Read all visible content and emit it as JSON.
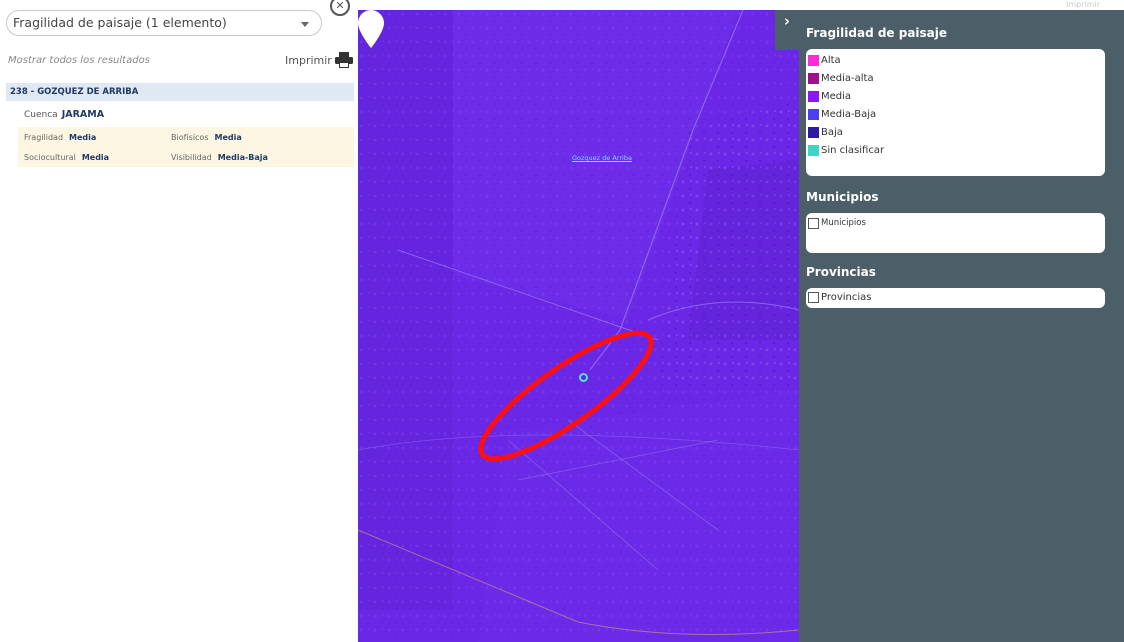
{
  "left_panel": {
    "layer_select": "Fragilidad de paisaje (1 elemento)",
    "show_all": "Mostrar todos los resultados",
    "print_label": "Imprimir",
    "result": {
      "title": "238 - GOZQUEZ DE ARRIBA",
      "cuenca_label": "Cuenca",
      "cuenca_value": "JARAMA",
      "attributes": [
        {
          "label": "Fragilidad",
          "value": "Media"
        },
        {
          "label": "Biofísicos",
          "value": "Media"
        },
        {
          "label": "Sociocultural",
          "value": "Media"
        },
        {
          "label": "Visibilidad",
          "value": "Media-Baja"
        }
      ]
    }
  },
  "map": {
    "label": "Gozquez de Arriba",
    "colors": {
      "base": "#6a28e6",
      "annotation": "#ff1010",
      "point": "#53e3e0"
    }
  },
  "right_panel": {
    "collapse_icon": "chevron-right-icon",
    "print_top": "Imprimir",
    "sections": [
      {
        "title": "Fragilidad de paisaje",
        "items": [
          {
            "label": "Alta",
            "color": "#ff2bd6"
          },
          {
            "label": "Media-alta",
            "color": "#a0108c"
          },
          {
            "label": "Media",
            "color": "#8a18f0"
          },
          {
            "label": "Media-Baja",
            "color": "#4b3ff0"
          },
          {
            "label": "Baja",
            "color": "#2c1aa0"
          },
          {
            "label": "Sin clasificar",
            "color": "#3fd4c4"
          }
        ]
      },
      {
        "title": "Municipios",
        "items": [
          {
            "label": "Municipios"
          }
        ]
      },
      {
        "title": "Provincias",
        "items": [
          {
            "label": "Provincias"
          }
        ]
      }
    ]
  }
}
